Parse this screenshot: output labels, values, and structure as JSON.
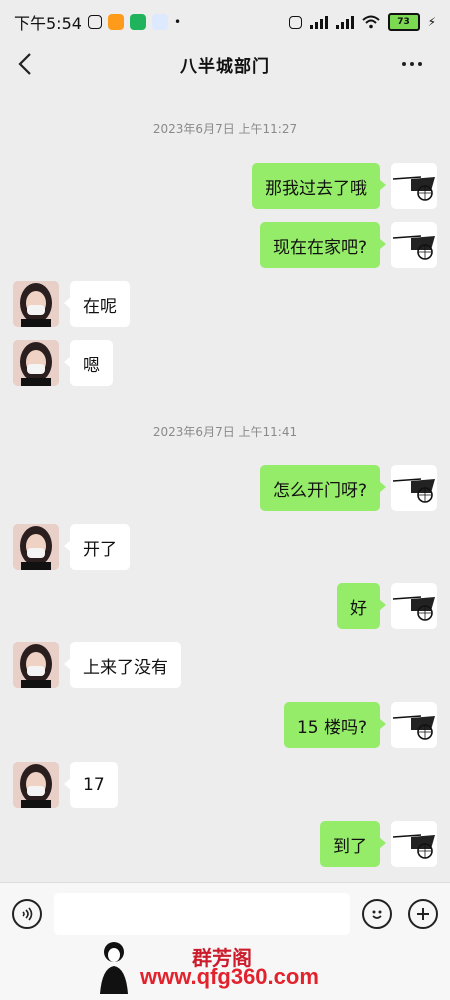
{
  "status": {
    "time": "下午5:54",
    "battery": "73"
  },
  "header": {
    "title": "八半城部门"
  },
  "chat": {
    "timestamps": [
      "2023年6月7日 上午11:27",
      "2023年6月7日 上午11:41"
    ],
    "messages": [
      {
        "side": "me",
        "text": "那我过去了哦"
      },
      {
        "side": "me",
        "text": "现在在家吧?"
      },
      {
        "side": "them",
        "text": "在呢"
      },
      {
        "side": "them",
        "text": "嗯"
      },
      {
        "side": "me",
        "text": "怎么开门呀?"
      },
      {
        "side": "them",
        "text": "开了"
      },
      {
        "side": "me",
        "text": "好"
      },
      {
        "side": "them",
        "text": "上来了没有"
      },
      {
        "side": "me",
        "text": "15 楼吗?"
      },
      {
        "side": "them",
        "text": "17"
      },
      {
        "side": "me",
        "text": "到了"
      }
    ]
  },
  "input": {
    "value": "",
    "placeholder": ""
  },
  "icons": {
    "back": "chevron-left-icon",
    "more": "more-dots-icon",
    "voice": "voice-icon",
    "emoji": "emoji-icon",
    "plus": "plus-icon"
  },
  "colors": {
    "my_bubble": "#95ec69",
    "their_bubble": "#ffffff",
    "background": "#ededed"
  },
  "watermark": {
    "brand": "群芳阁",
    "url": "www.qfg360.com"
  }
}
